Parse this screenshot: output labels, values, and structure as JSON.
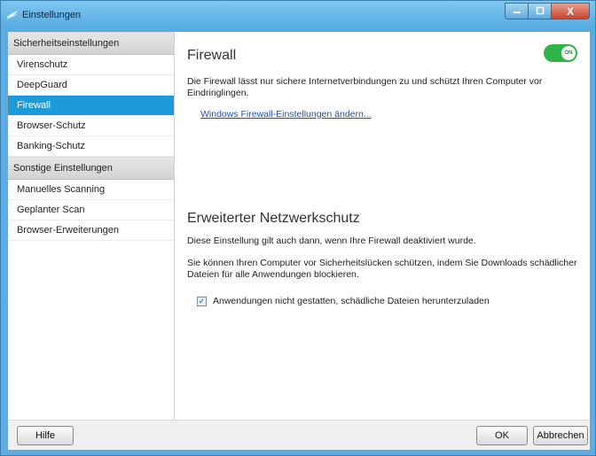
{
  "window": {
    "title": "Einstellungen",
    "minimize_icon": "minimize-icon",
    "maximize_icon": "maximize-icon",
    "close_glyph": "X"
  },
  "sidebar": {
    "sections": [
      {
        "header": "Sicherheitseinstellungen",
        "items": [
          {
            "label": "Virenschutz"
          },
          {
            "label": "DeepGuard"
          },
          {
            "label": "Firewall",
            "selected": true
          },
          {
            "label": "Browser-Schutz"
          },
          {
            "label": "Banking-Schutz"
          }
        ]
      },
      {
        "header": "Sonstige Einstellungen",
        "items": [
          {
            "label": "Manuelles Scanning"
          },
          {
            "label": "Geplanter Scan"
          },
          {
            "label": "Browser-Erweiterungen"
          }
        ]
      }
    ]
  },
  "firewall": {
    "title": "Firewall",
    "toggle_label": "ON",
    "toggle_state": true,
    "description": "Die Firewall lässt nur sichere Internetverbindungen zu und schützt Ihren Computer vor Eindringlingen.",
    "link": "Windows Firewall-Einstellungen ändern..."
  },
  "network": {
    "title": "Erweiterter Netzwerkschutz",
    "note": "Diese Einstellung gilt auch dann, wenn Ihre Firewall deaktiviert wurde.",
    "description": "Sie können Ihren Computer vor Sicherheitslücken schützen, indem Sie Downloads schädlicher Dateien für alle Anwendungen blockieren.",
    "checkbox_label": "Anwendungen nicht gestatten, schädliche Dateien herunterzuladen",
    "checkbox_checked": true,
    "checkbox_glyph": "✓"
  },
  "footer": {
    "help": "Hilfe",
    "ok": "OK",
    "cancel": "Abbrechen"
  },
  "colors": {
    "accent": "#1d9bd8",
    "toggle_on": "#31b34a",
    "link": "#1e4fb8"
  }
}
